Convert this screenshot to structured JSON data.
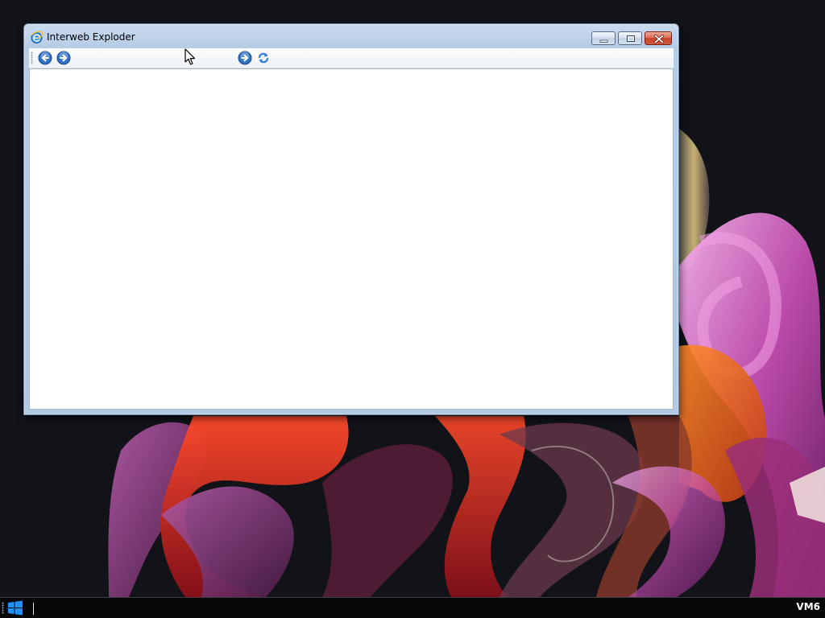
{
  "window": {
    "title": "Interweb Exploder",
    "app_icon": "internet-explorer-e-icon",
    "caption_buttons": {
      "minimize": "minimize-icon",
      "maximize": "maximize-icon",
      "close": "close-x-icon"
    }
  },
  "toolbar": {
    "back_icon": "back-arrow-icon",
    "forward_icon": "forward-arrow-icon",
    "address_value": "",
    "address_placeholder": "",
    "go_icon": "go-arrow-icon",
    "refresh_icon": "refresh-icon"
  },
  "taskbar": {
    "start_icon": "windows-logo-icon",
    "machine_label": "VM6"
  },
  "colors": {
    "desktop_background": "#111319",
    "window_frame": "#b7cde6",
    "close_button": "#c7412a",
    "nav_button_blue": "#2f6fc4",
    "taskbar": "#050608",
    "start_logo": "#1e90ff"
  }
}
